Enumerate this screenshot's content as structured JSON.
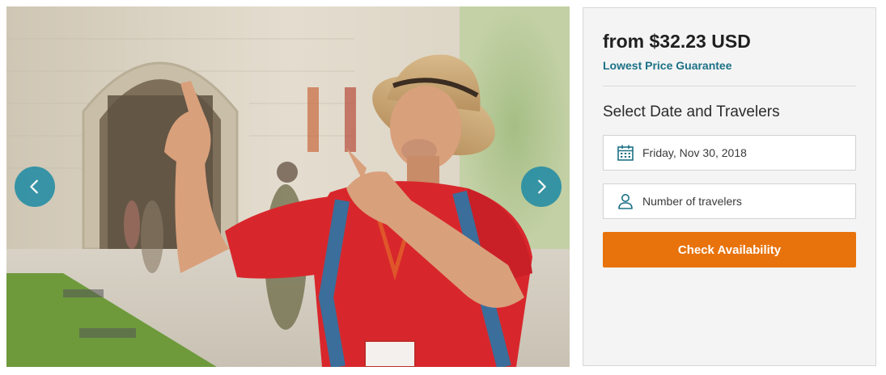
{
  "carousel": {
    "photo_alt": "Tour guide in a straw hat and red polo shirt pointing upward in front of an old stone city gate",
    "prev_icon": "chevron-left-icon",
    "next_icon": "chevron-right-icon",
    "nav_color": "#2a8fa4"
  },
  "booking": {
    "price": "from $32.23 USD",
    "guarantee": "Lowest Price Guarantee",
    "section_title": "Select Date and Travelers",
    "date_value": "Friday, Nov 30, 2018",
    "date_icon": "calendar-icon",
    "travelers_placeholder": "Number of travelers",
    "travelers_icon": "person-icon",
    "cta_label": "Check Availability",
    "accent_color": "#1c7186",
    "cta_color": "#e8730c"
  }
}
